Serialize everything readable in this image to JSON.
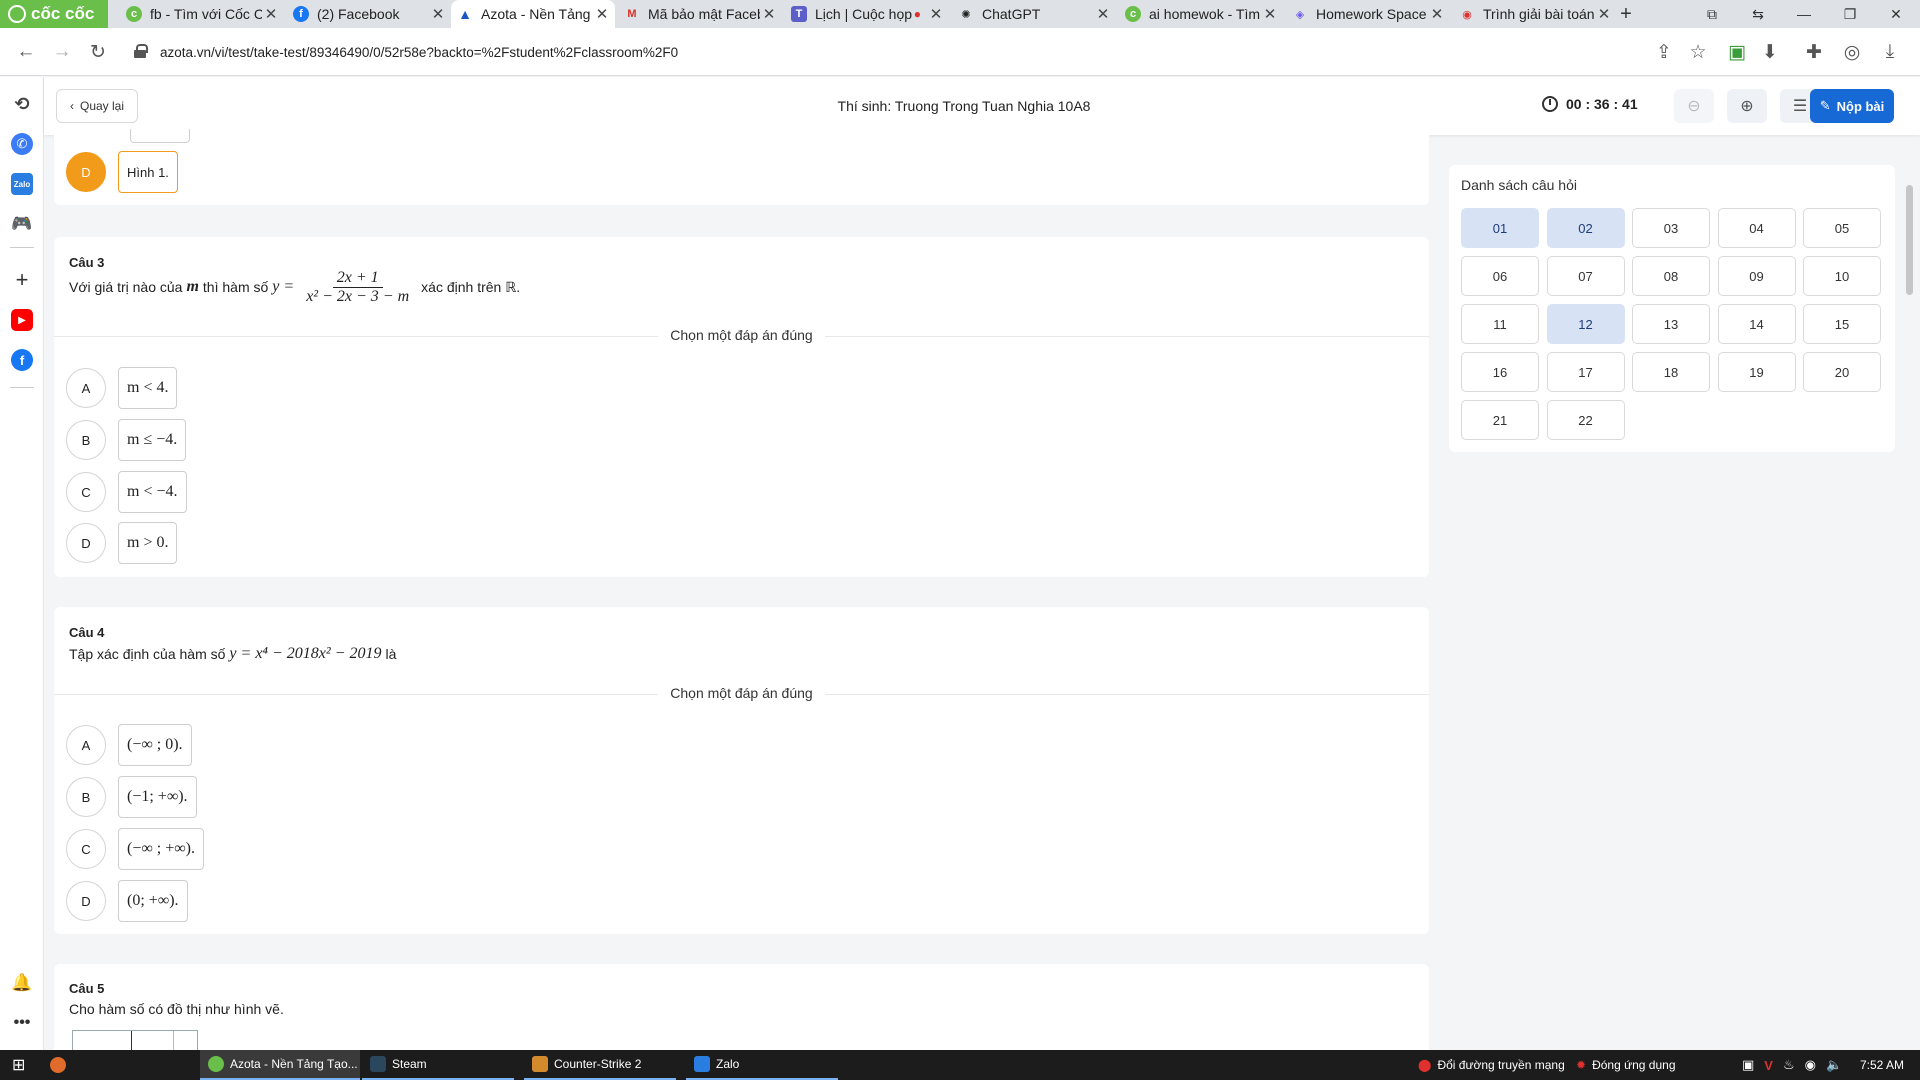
{
  "browser": {
    "brand": "cốc cốc",
    "tabs": [
      {
        "title": "fb - Tìm với Cốc Cốc",
        "favicon": "coccoc-icon",
        "active": false
      },
      {
        "title": "(2) Facebook",
        "favicon": "facebook-icon",
        "active": false
      },
      {
        "title": "Azota - Nền Tảng Tạo",
        "favicon": "azota-icon",
        "active": true
      },
      {
        "title": "Mã bảo mật Facebook",
        "favicon": "gmail-icon",
        "active": false
      },
      {
        "title": "Lịch | Cuộc họp",
        "favicon": "teams-icon",
        "active": false
      },
      {
        "title": "ChatGPT",
        "favicon": "chatgpt-icon",
        "active": false
      },
      {
        "title": "ai homewok - Tìm",
        "favicon": "coccoc-icon",
        "active": false
      },
      {
        "title": "Homework Space",
        "favicon": "homework-icon",
        "active": false
      },
      {
        "title": "Trình giải bài toán",
        "favicon": "solver-icon",
        "active": false
      }
    ],
    "url": "azota.vn/vi/test/take-test/89346490/0/52r58e?backto=%2Fstudent%2Fclassroom%2F0"
  },
  "header": {
    "back_label": "Quay lại",
    "candidate": "Thí sinh: Truong Trong Tuan Nghia 10A8",
    "timer": "00 : 36 : 41",
    "submit_label": "Nộp bài"
  },
  "partial_question": {
    "option_letter": "D",
    "option_text": "Hình 1."
  },
  "choose_label": "Chọn một đáp án đúng",
  "questions": {
    "q3": {
      "number": "Câu 3",
      "text_before": "Với giá trị nào của",
      "var": "m",
      "text_mid": "thì hàm số",
      "y_eq": "y =",
      "numerator": "2x + 1",
      "denominator": "x² − 2x − 3 − m",
      "text_after": "xác định trên ℝ.",
      "options": [
        {
          "letter": "A",
          "text": "m < 4."
        },
        {
          "letter": "B",
          "text": "m ≤ −4."
        },
        {
          "letter": "C",
          "text": "m < −4."
        },
        {
          "letter": "D",
          "text": "m > 0."
        }
      ]
    },
    "q4": {
      "number": "Câu 4",
      "text_before": "Tập xác định của hàm số",
      "formula": "y = x⁴ − 2018x² − 2019",
      "text_after": "là",
      "options": [
        {
          "letter": "A",
          "text": "(−∞ ; 0)."
        },
        {
          "letter": "B",
          "text": "(−1; +∞)."
        },
        {
          "letter": "C",
          "text": "(−∞ ; +∞)."
        },
        {
          "letter": "D",
          "text": "(0; +∞)."
        }
      ]
    },
    "q5": {
      "number": "Câu 5",
      "text": "Cho hàm số có đồ thị như hình vẽ."
    }
  },
  "question_panel": {
    "title": "Danh sách câu hỏi",
    "items": [
      "01",
      "02",
      "03",
      "04",
      "05",
      "06",
      "07",
      "08",
      "09",
      "10",
      "11",
      "12",
      "13",
      "14",
      "15",
      "16",
      "17",
      "18",
      "19",
      "20",
      "21",
      "22"
    ],
    "answered": [
      "01",
      "02",
      "12"
    ]
  },
  "taskbar": {
    "items": [
      {
        "label": "Azota - Nền Tảng Tạo...",
        "icon": "coccoc-icon"
      },
      {
        "label": "Steam",
        "icon": "steam-icon"
      },
      {
        "label": "Counter-Strike 2",
        "icon": "cs2-icon"
      },
      {
        "label": "Zalo",
        "icon": "zalo-icon"
      }
    ],
    "notice1": "Đổi đường truyền mạng",
    "notice2": "Đóng ứng dụng",
    "clock": "7:52 AM"
  }
}
